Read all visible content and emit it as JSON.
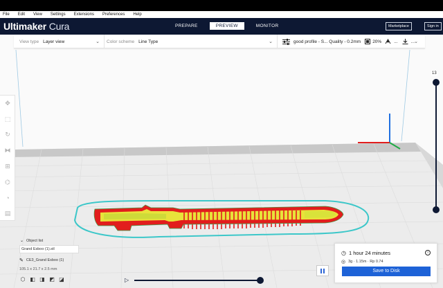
{
  "menu": [
    "File",
    "Edit",
    "View",
    "Settings",
    "Extensions",
    "Preferences",
    "Help"
  ],
  "app": {
    "brand": "Ultimaker",
    "product": "Cura"
  },
  "stages": [
    {
      "label": "PREPARE"
    },
    {
      "label": "PREVIEW"
    },
    {
      "label": "MONITOR"
    }
  ],
  "header_buttons": {
    "marketplace": "Marketplace",
    "signin": "Sign in"
  },
  "view_type": {
    "label": "View type",
    "value": "Layer view"
  },
  "color_scheme": {
    "label": "Color scheme",
    "value": "Line Type"
  },
  "print_setup": {
    "profile": "good profile - S... Quality - 0.2mm",
    "infill": "20%",
    "more": "..."
  },
  "layer": {
    "current": "13"
  },
  "object_list": {
    "title": "Object list",
    "file": "Grand Esboo (1).stl",
    "object_name": "CE3_Grand Esboo (1)",
    "dimensions": "105.1 x 21.7 x 2.5 mm"
  },
  "print_info": {
    "time": "1 hour 24 minutes",
    "material": "3g · 1.15m · Rp 0.74",
    "save_label": "Save to Disk"
  },
  "colors": {
    "header": "#0d1833",
    "accent": "#1d62d7",
    "wall": "#e21d1d",
    "infill": "#e8e23a",
    "skirt": "#3cc7c9"
  }
}
